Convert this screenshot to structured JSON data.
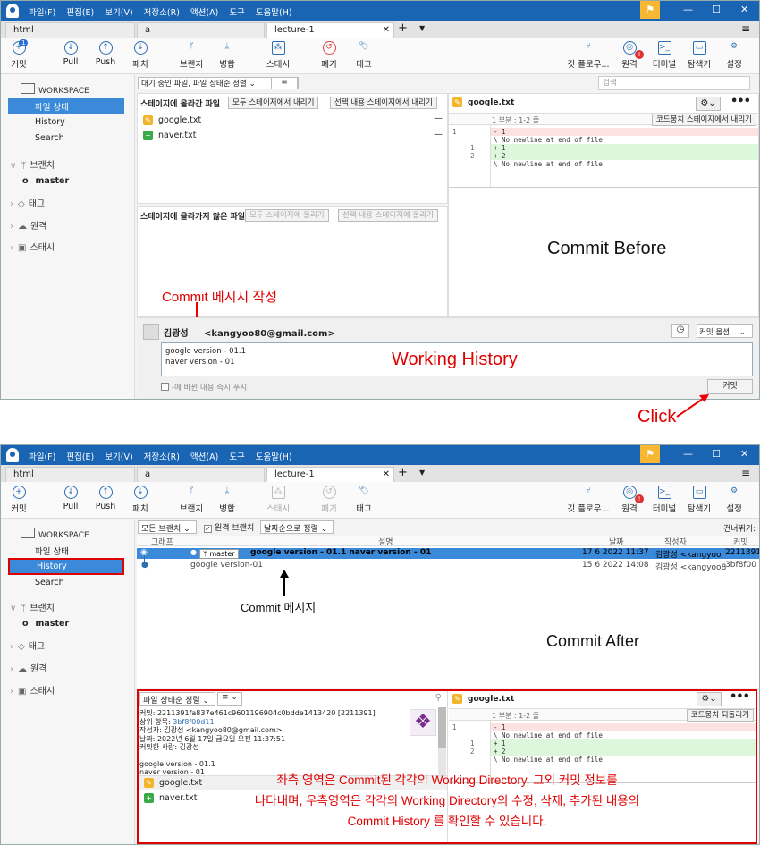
{
  "menu": [
    "파일(F)",
    "편집(E)",
    "보기(V)",
    "저장소(R)",
    "액션(A)",
    "도구",
    "도움말(H)"
  ],
  "tabs": [
    "html",
    "a",
    "lecture-1"
  ],
  "toolbar": {
    "commit": "커밋",
    "commit_badge": "1",
    "pull": "Pull",
    "push": "Push",
    "fetch": "패치",
    "branch": "브랜치",
    "merge": "병합",
    "stash": "스태시",
    "discard": "폐기",
    "tag": "태그",
    "gitflow": "깃 플로우...",
    "remote": "원격",
    "terminal": "터미널",
    "explorer": "탐색기",
    "settings": "설정",
    "remote_badge": "!"
  },
  "sidebar": {
    "workspace": "WORKSPACE",
    "file_status": "파일 상태",
    "history": "History",
    "search": "Search",
    "branches": "브랜치",
    "master": "master",
    "tags": "태그",
    "remotes": "원격",
    "stashes": "스태시"
  },
  "top": {
    "filter": "대기 중인 파일, 파일 상태순 정렬",
    "view_icon": "≡",
    "search_placeholder": "검색",
    "staged_title": "스테이지에 올라간 파일",
    "unstage_all": "모두 스테이지에서 내리기",
    "unstage_sel": "선택 내용 스테이지에서 내리기",
    "staged_files": [
      "google.txt",
      "naver.txt"
    ],
    "unstaged_title": "스테이지에 올라가지 않은 파일",
    "stage_all": "모두 스테이지에 올리기",
    "stage_sel": "선택 내용 스테이지에 올리기",
    "diff_file": "google.txt",
    "hunk": "1 부분 : 1-2 줄",
    "hunk_btn": "코드뭉치 스테이지에서 내리기",
    "diff_lines": [
      {
        "o": "1",
        "n": "",
        "t": "- 1",
        "k": "del"
      },
      {
        "o": "",
        "n": "",
        "t": "\\  No newline at end of file",
        "k": "ctx"
      },
      {
        "o": "",
        "n": "1",
        "t": "+ 1",
        "k": "ins"
      },
      {
        "o": "",
        "n": "2",
        "t": "+ 2",
        "k": "ins"
      },
      {
        "o": "",
        "n": "",
        "t": "\\  No newline at end of file",
        "k": "ctx"
      }
    ],
    "author": "김광성",
    "email": "<kangyoo80@gmail.com>",
    "commit_message": [
      "google version - 01.1",
      "naver version - 01"
    ],
    "commit_options": "커밋 옵션...",
    "push_now": "-에 바뀐 내용 즉시 푸시",
    "commit_btn": "커밋",
    "ann_before": "Commit Before",
    "ann_msg": "Commit 메시지 작성",
    "ann_working": "Working History",
    "ann_click": "Click"
  },
  "bottom": {
    "all_branches": "모든 브랜치",
    "show_remote": "원격 브랜치",
    "date_sort": "날짜순으로 정렬",
    "jump": "건너뛰기:",
    "cols": [
      "그래프",
      "설명",
      "날짜",
      "작성자",
      "커밋"
    ],
    "rows": [
      {
        "branch": "master",
        "desc": "google version - 01.1 naver version - 01",
        "date": "17 6 2022 11:37",
        "author": "김광성 <kangyoo",
        "hash": "2211391"
      },
      {
        "branch": "",
        "desc": "google version-01",
        "date": "15 6 2022 14:08",
        "author": "김광성 <kangyoo8",
        "hash": "3bf8f00"
      }
    ],
    "ann_msg": "Commit 메시지",
    "ann_after": "Commit After",
    "file_sort": "파일 상태순 정렬",
    "details": [
      "커밋: 2211391fa837e461c9601196904c0bdde1413420 [2211391]",
      "작성자: 김광성 <kangyoo80@gmail.com>",
      "날짜: 2022년 6월 17일 금요일 오전 11:37:51",
      "커밋한 사람: 김광성"
    ],
    "parent_label": "상위 항목: ",
    "parent_hash": "3bf8f00d11",
    "message": [
      "google version - 01.1",
      "naver version - 01"
    ],
    "files": [
      "google.txt",
      "naver.txt"
    ],
    "diff_file": "google.txt",
    "hunk": "1 부분 : 1-2 줄",
    "hunk_btn": "코드뭉치 되돌리기",
    "diff_lines": [
      {
        "o": "1",
        "n": "",
        "t": "- 1",
        "k": "del"
      },
      {
        "o": "",
        "n": "",
        "t": "\\  No newline at end of file",
        "k": "ctx"
      },
      {
        "o": "",
        "n": "1",
        "t": "+ 1",
        "k": "ins"
      },
      {
        "o": "",
        "n": "2",
        "t": "+ 2",
        "k": "ins"
      },
      {
        "o": "",
        "n": "",
        "t": "\\  No newline at end of file",
        "k": "ctx"
      }
    ],
    "ann_explain": [
      "좌측 영역은 Commit된 각각의 Working Directory, 그외 커밋 정보를",
      "나타내며, 우측영역은 각각의 Working Directory의 수정, 삭제, 추가된 내용의",
      "Commit History 를 확인할 수 있습니다."
    ]
  }
}
